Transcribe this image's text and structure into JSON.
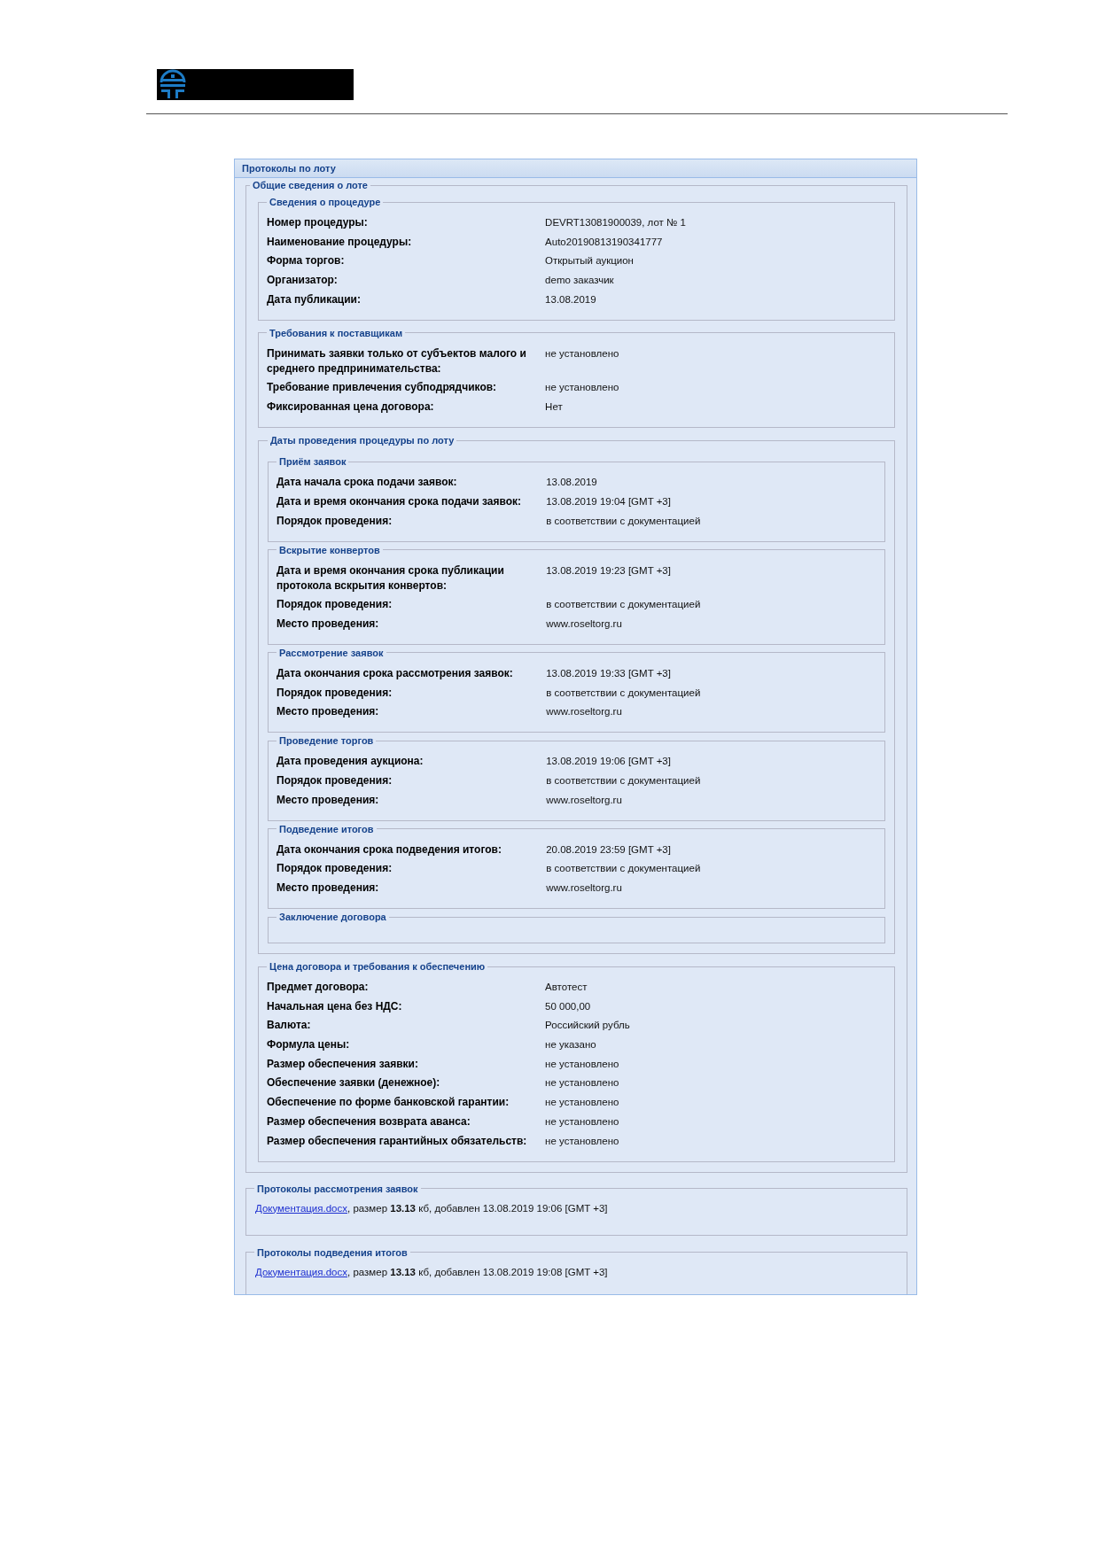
{
  "panel": {
    "title": "Протоколы по лоту",
    "general": {
      "legend": "Общие сведения о лоте",
      "children": [
        {
          "legend": "Сведения о процедуре",
          "rows": [
            {
              "label": "Номер процедуры:",
              "value": "DEVRT13081900039, лот № 1"
            },
            {
              "label": "Наименование процедуры:",
              "value": "Auto20190813190341777"
            },
            {
              "label": "Форма торгов:",
              "value": "Открытый аукцион"
            },
            {
              "label": "Организатор:",
              "value": "demo заказчик"
            },
            {
              "label": "Дата публикации:",
              "value": "13.08.2019"
            }
          ]
        },
        {
          "legend": "Требования к поставщикам",
          "rows": [
            {
              "label": "Принимать заявки только от субъектов малого и среднего предпринимательства:",
              "value": "не установлено"
            },
            {
              "label": "Требование привлечения субподрядчиков:",
              "value": "не установлено"
            },
            {
              "label": "Фиксированная цена договора:",
              "value": "Нет"
            }
          ]
        },
        {
          "legend": "Даты проведения процедуры по лоту",
          "children": [
            {
              "legend": "Приём заявок",
              "rows": [
                {
                  "label": "Дата начала срока подачи заявок:",
                  "value": "13.08.2019"
                },
                {
                  "label": "Дата и время окончания срока подачи заявок:",
                  "value": "13.08.2019 19:04 [GMT +3]"
                },
                {
                  "label": "Порядок проведения:",
                  "value": "в соответствии с документацией"
                }
              ]
            },
            {
              "legend": "Вскрытие конвертов",
              "rows": [
                {
                  "label": "Дата и время окончания срока публикации протокола вскрытия конвертов:",
                  "value": "13.08.2019 19:23 [GMT +3]"
                },
                {
                  "label": "Порядок проведения:",
                  "value": "в соответствии с документацией"
                },
                {
                  "label": "Место проведения:",
                  "value": "www.roseltorg.ru"
                }
              ]
            },
            {
              "legend": "Рассмотрение заявок",
              "rows": [
                {
                  "label": "Дата окончания срока рассмотрения заявок:",
                  "value": "13.08.2019 19:33 [GMT +3]"
                },
                {
                  "label": "Порядок проведения:",
                  "value": "в соответствии с документацией"
                },
                {
                  "label": "Место проведения:",
                  "value": "www.roseltorg.ru"
                }
              ]
            },
            {
              "legend": "Проведение торгов",
              "rows": [
                {
                  "label": "Дата проведения аукциона:",
                  "value": "13.08.2019 19:06 [GMT +3]"
                },
                {
                  "label": "Порядок проведения:",
                  "value": "в соответствии с документацией"
                },
                {
                  "label": "Место проведения:",
                  "value": "www.roseltorg.ru"
                }
              ]
            },
            {
              "legend": "Подведение итогов",
              "rows": [
                {
                  "label": "Дата окончания срока подведения итогов:",
                  "value": "20.08.2019 23:59 [GMT +3]"
                },
                {
                  "label": "Порядок проведения:",
                  "value": "в соответствии с документацией"
                },
                {
                  "label": "Место проведения:",
                  "value": "www.roseltorg.ru"
                }
              ]
            },
            {
              "legend": "Заключение договора"
            }
          ]
        },
        {
          "legend": "Цена договора и требования к обеспечению",
          "rows": [
            {
              "label": "Предмет договора:",
              "value": "Автотест"
            },
            {
              "label": "Начальная цена без НДС:",
              "value": "50 000,00"
            },
            {
              "label": "Валюта:",
              "value": "Российский рубль"
            },
            {
              "label": "Формула цены:",
              "value": "не указано"
            },
            {
              "label": "Размер обеспечения заявки:",
              "value": "не установлено"
            },
            {
              "label": "Обеспечение заявки (денежное):",
              "value": "не установлено"
            },
            {
              "label": "Обеспечение по форме банковской гарантии:",
              "value": "не установлено"
            },
            {
              "label": "Размер обеспечения возврата аванса:",
              "value": "не установлено"
            },
            {
              "label": "Размер обеспечения гарантийных обязательств:",
              "value": "не установлено"
            }
          ]
        }
      ]
    },
    "protocols": [
      {
        "legend": "Протоколы рассмотрения заявок",
        "files": [
          {
            "link": "Документация.docx",
            "text": ", размер **13.13** кб, добавлен 13.08.2019 19:06 [GMT +3]"
          }
        ]
      },
      {
        "legend": "Протоколы подведения итогов",
        "files": [
          {
            "link": "Документация.docx",
            "text": ", размер **13.13** кб, добавлен 13.08.2019 19:08 [GMT +3]"
          }
        ]
      }
    ]
  }
}
